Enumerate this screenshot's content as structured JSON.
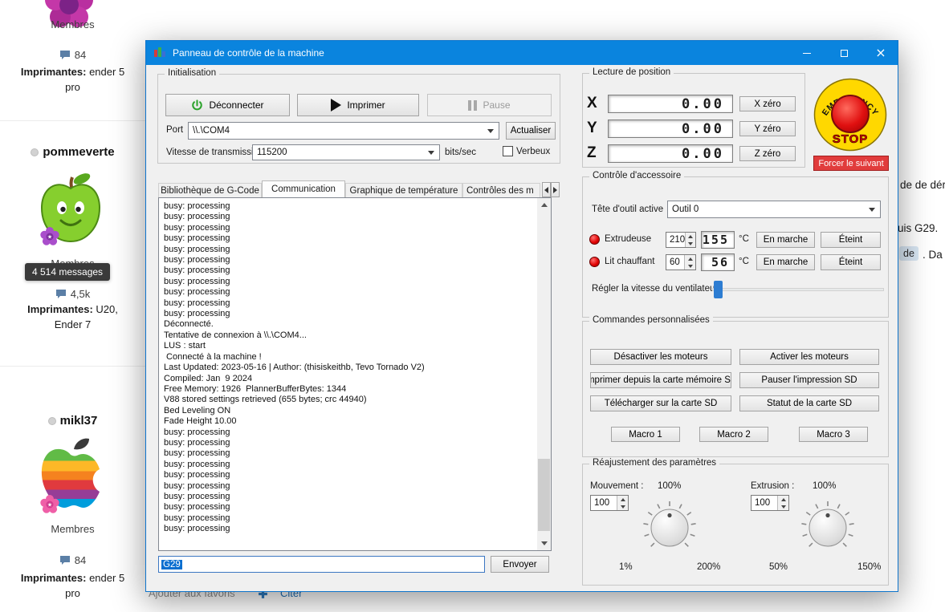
{
  "forum": {
    "profiles": [
      {
        "group": "Membres",
        "count": "84",
        "printers_label": "Imprimantes:",
        "printers_rest": " ender 5",
        "printers_line2": "pro"
      },
      {
        "name": "pommeverte",
        "group": "Membres",
        "tooltip": "4 514 messages",
        "count": "4,5k",
        "printers_label": "Imprimantes:",
        "printers_rest": " U20,",
        "printers_line2": "Ender 7"
      },
      {
        "name": "mikl37",
        "group": "Membres",
        "count": "84",
        "printers_label": "Imprimantes:",
        "printers_rest": " ender 5",
        "printers_line2": "pro"
      }
    ],
    "footer": {
      "favorites": "Ajouter aux favoris",
      "quote": "Citer"
    },
    "fragments": [
      "de de dér",
      "uis G29.",
      "de",
      ". Da"
    ]
  },
  "window": {
    "title": "Panneau de contrôle de la machine"
  },
  "init": {
    "label": "Initialisation",
    "disconnect": "Déconnecter",
    "print": "Imprimer",
    "pause": "Pause",
    "port_label": "Port",
    "port_value": "\\\\.\\COM4",
    "refresh": "Actualiser",
    "baud_label": "Vitesse de transmission",
    "baud_value": "115200",
    "baud_unit": "bits/sec",
    "verbose": "Verbeux"
  },
  "tabs": [
    "Bibliothèque de G-Code",
    "Communication",
    "Graphique de température",
    "Contrôles des m"
  ],
  "log": {
    "lines": [
      "busy: processing",
      "busy: processing",
      "busy: processing",
      "busy: processing",
      "busy: processing",
      "busy: processing",
      "busy: processing",
      "busy: processing",
      "busy: processing",
      "busy: processing",
      "busy: processing",
      "Déconnecté.",
      "Tentative de connexion à \\\\.\\COM4...",
      "LUS : start",
      " Connecté à la machine !",
      "Last Updated: 2023-05-16 | Author: (thisiskeithb, Tevo Tornado V2)",
      "Compiled: Jan  9 2024",
      "Free Memory: 1926  PlannerBufferBytes: 1344",
      "V88 stored settings retrieved (655 bytes; crc 44940)",
      "Bed Leveling ON",
      "Fade Height 10.00",
      "busy: processing",
      "busy: processing",
      "busy: processing",
      "busy: processing",
      "busy: processing",
      "busy: processing",
      "busy: processing",
      "busy: processing",
      "busy: processing",
      "busy: processing"
    ],
    "input_value": "G29",
    "send": "Envoyer"
  },
  "position": {
    "label": "Lecture de position",
    "axes": [
      {
        "name": "X",
        "value": "0.00",
        "zero": "X zéro"
      },
      {
        "name": "Y",
        "value": "0.00",
        "zero": "Y zéro"
      },
      {
        "name": "Z",
        "value": "0.00",
        "zero": "Z zéro"
      }
    ]
  },
  "emergency": {
    "top": "EMERGENCY",
    "stop": "STOP",
    "force": "Forcer le suivant"
  },
  "accessory": {
    "label": "Contrôle d'accessoire",
    "tool_label": "Tête d'outil active",
    "tool_value": "Outil 0",
    "heaters": [
      {
        "name": "Extrudeuse",
        "target": "210",
        "current": "155",
        "unit": "°C",
        "on": "En marche",
        "off": "Éteint"
      },
      {
        "name": "Lit chauffant",
        "target": "60",
        "current": "56",
        "unit": "°C",
        "on": "En marche",
        "off": "Éteint"
      }
    ],
    "fan_label": "Régler la vitesse du ventilateur"
  },
  "custom": {
    "label": "Commandes personnalisées",
    "buttons": [
      "Désactiver les moteurs",
      "Activer les moteurs",
      "Imprimer depuis la carte mémoire SD",
      "Pauser l'impression SD",
      "Télécharger sur la carte SD",
      "Statut de la carte SD"
    ],
    "macros": [
      "Macro 1",
      "Macro 2",
      "Macro 3"
    ]
  },
  "adjust": {
    "label": "Réajustement des paramètres",
    "move": {
      "label": "Mouvement :",
      "value": "100",
      "top": "100%",
      "min": "1%",
      "max": "200%"
    },
    "extrude": {
      "label": "Extrusion :",
      "value": "100",
      "top": "100%",
      "min": "50%",
      "max": "150%"
    }
  }
}
